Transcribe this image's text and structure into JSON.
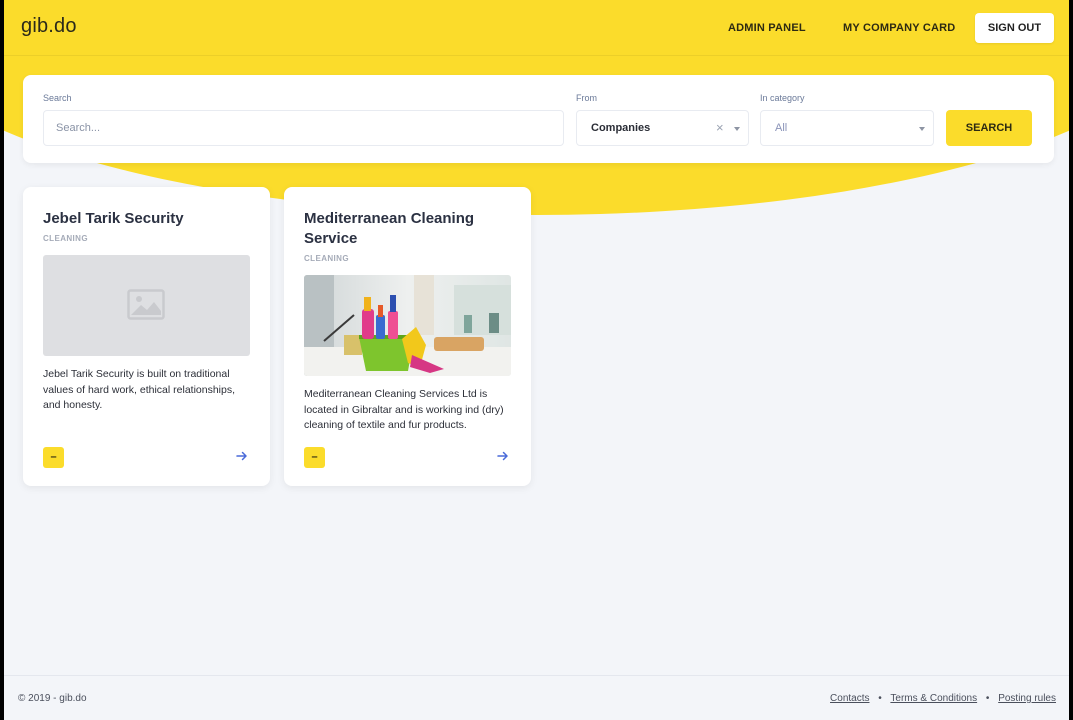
{
  "brand": {
    "logo_text": "gib.do",
    "accent_color": "#fbdc2b"
  },
  "nav": {
    "admin_panel": "ADMIN PANEL",
    "company_card": "MY COMPANY CARD",
    "sign_out": "SIGN OUT"
  },
  "search": {
    "search_label": "Search",
    "search_placeholder": "Search...",
    "from_label": "From",
    "from_value": "Companies",
    "clear_symbol": "×",
    "category_label": "In category",
    "category_value": "All",
    "button_label": "SEARCH"
  },
  "cards": [
    {
      "title": "Jebel Tarik Security",
      "category": "CLEANING",
      "image": "placeholder-image-icon",
      "description": "Jebel Tarik Security is built on traditional values of hard work, ethical relationships, and honesty.",
      "button_label": "–",
      "arrow": "arrow-right-icon"
    },
    {
      "title": "Mediterranean Cleaning Service",
      "category": "CLEANING",
      "image": "cleaning-supplies-bucket-photo",
      "description": "Mediterranean Cleaning Services Ltd is located in Gibraltar and is working ind (dry) cleaning of textile and fur products.",
      "button_label": "–",
      "arrow": "arrow-right-icon"
    }
  ],
  "footer": {
    "copyright": "© 2019 - gib.do",
    "links": [
      "Contacts",
      "Terms & Conditions",
      "Posting rules"
    ],
    "separator": "•"
  }
}
